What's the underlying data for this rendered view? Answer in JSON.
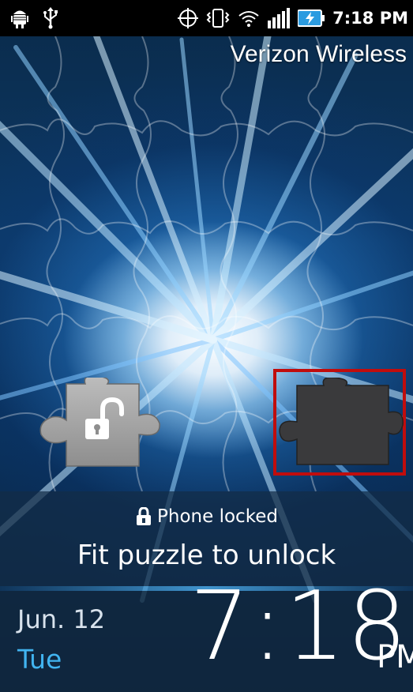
{
  "status_bar": {
    "time": "7:18 PM",
    "icons": [
      "android-debug-icon",
      "usb-icon",
      "gps-icon",
      "vibrate-icon",
      "wifi-icon",
      "signal-icon",
      "battery-charging-icon"
    ]
  },
  "carrier": "Verizon Wireless",
  "lock": {
    "status": "Phone locked",
    "instruction": "Fit puzzle to unlock"
  },
  "clock": {
    "date": "Jun. 12",
    "day": "Tue",
    "time": "7:18",
    "ampm": "PM"
  },
  "colors": {
    "target_frame": "#c00d0d",
    "day_text": "#41b4f0",
    "status_bar_bg": "#000000",
    "battery_fill": "#2b9be0"
  }
}
